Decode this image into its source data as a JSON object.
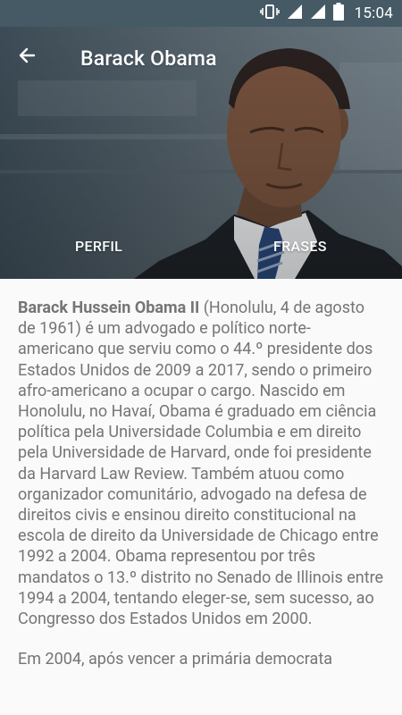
{
  "status_bar": {
    "time": "15:04",
    "icons": [
      "vibrate-icon",
      "signal-icon",
      "wifi-signal-icon",
      "battery-icon"
    ]
  },
  "app_bar": {
    "title": "Barack Obama",
    "back_icon": "arrow-back-icon"
  },
  "tabs": [
    {
      "label": "PERFIL",
      "selected": true
    },
    {
      "label": "FRASES",
      "selected": false
    }
  ],
  "biography": {
    "name_bold": "Barack Hussein Obama II",
    "paragraph1_rest": " (Honolulu, 4 de agosto de 1961) é um advogado e político norte-americano que serviu como o 44.º presidente dos Estados Unidos de 2009 a 2017, sendo o primeiro afro-americano a ocupar o cargo. Nascido em Honolulu, no Havaí, Obama é graduado em ciência política pela Universidade Columbia e em direito pela Universidade de Harvard, onde foi presidente da Harvard Law Review. Também atuou como organizador comunitário, advogado na defesa de direitos civis e ensinou direito constitucional na escola de direito da Universidade de Chicago entre 1992 a 2004. Obama representou por três mandatos o 13.º distrito no Senado de Illinois entre 1994 a 2004, tentando eleger-se, sem sucesso, ao Congresso dos Estados Unidos em 2000.",
    "paragraph2_partial": "Em 2004, após vencer a primária democrata"
  },
  "colors": {
    "status_bar": "#455a64",
    "text": "#757575",
    "background": "#fafafa"
  }
}
